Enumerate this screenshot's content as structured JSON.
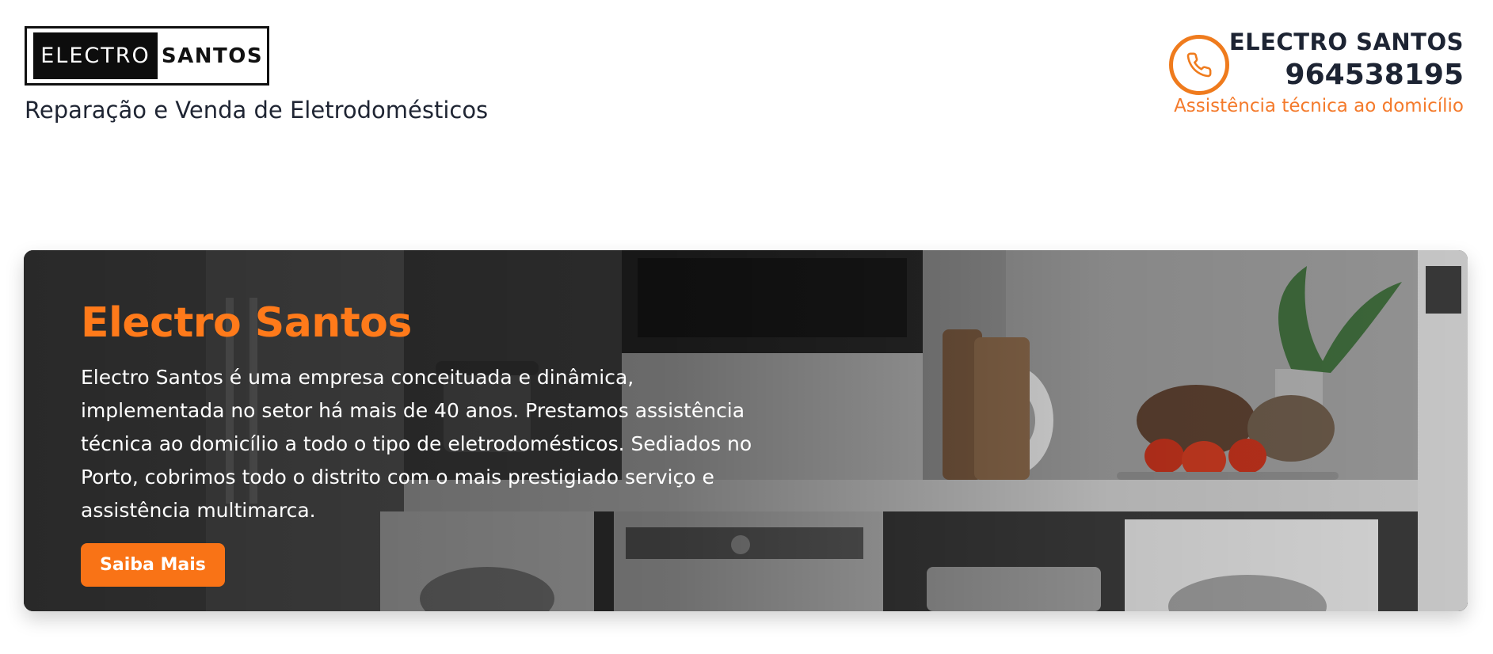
{
  "header": {
    "logo": {
      "left_text": "ELECTRO",
      "right_text": "SANTOS"
    },
    "tagline": "Reparação e Venda de Eletrodomésticos",
    "contact": {
      "icon": "phone-icon",
      "name": "ELECTRO SANTOS",
      "phone": "964538195",
      "subtitle": "Assistência técnica ao domicílio"
    }
  },
  "hero": {
    "title": "Electro Santos",
    "description": "Electro Santos é uma empresa conceituada e dinâmica, implementada no setor há mais de 40 anos. Prestamos assistência técnica ao domicílio a todo o tipo de eletrodomésticos. Sediados no Porto, cobrimos todo o distrito com o mais prestigiado serviço e assistência multimarca.",
    "button_label": "Saiba Mais",
    "background": "kitchen-appliances-photo"
  },
  "colors": {
    "accent": "#f97316",
    "dark_text": "#1d2433"
  }
}
